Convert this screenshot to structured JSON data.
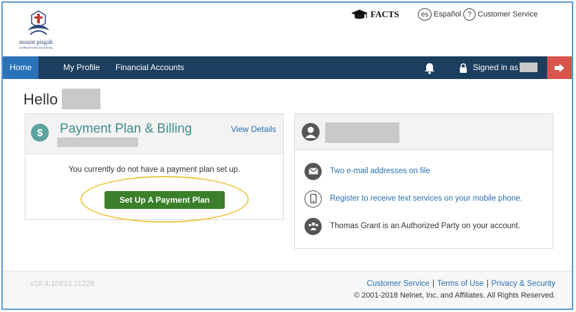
{
  "brand": {
    "school_line1": "mount pisgah",
    "school_line2": "CHRISTIAN SCHOOL",
    "facts_label": "FACTS"
  },
  "utility": {
    "espanol_badge": "es",
    "espanol_label": "Español",
    "help_badge": "?",
    "service_label": "Customer Service"
  },
  "nav": {
    "items": [
      {
        "label": "Home"
      },
      {
        "label": "My Profile"
      },
      {
        "label": "Financial Accounts"
      }
    ],
    "signed_in_label": "Signed in as"
  },
  "greeting": "Hello",
  "payment_card": {
    "icon_glyph": "$",
    "title": "Payment Plan & Billing",
    "view_details": "View Details",
    "message": "You currently do not have a payment plan set up.",
    "button_label": "Set Up A Payment Plan"
  },
  "profile_card": {
    "rows": [
      {
        "icon": "mail-icon",
        "text": "Two e-mail addresses on file",
        "link": true
      },
      {
        "icon": "mobile-phone-icon",
        "text": "Register to receive text services on your mobile phone.",
        "link": true
      },
      {
        "icon": "group-icon",
        "text": "Thomas Grant is an Authorized Party on your account.",
        "link": false
      }
    ]
  },
  "footer": {
    "version": "v18.4.10813.11228",
    "links": [
      "Customer Service",
      "Terms of Use",
      "Privacy & Security"
    ],
    "copyright": "© 2001-2018 Nelnet, Inc. and Affiliates. All Rights Reserved."
  },
  "colors": {
    "nav_bg": "#1c3f5f",
    "nav_active": "#2a73b9",
    "logout_bg": "#d9534f",
    "accent_teal": "#3c8f88",
    "button_green": "#3b7f2a",
    "highlight": "#ecc94b",
    "link": "#2a6fb0"
  }
}
